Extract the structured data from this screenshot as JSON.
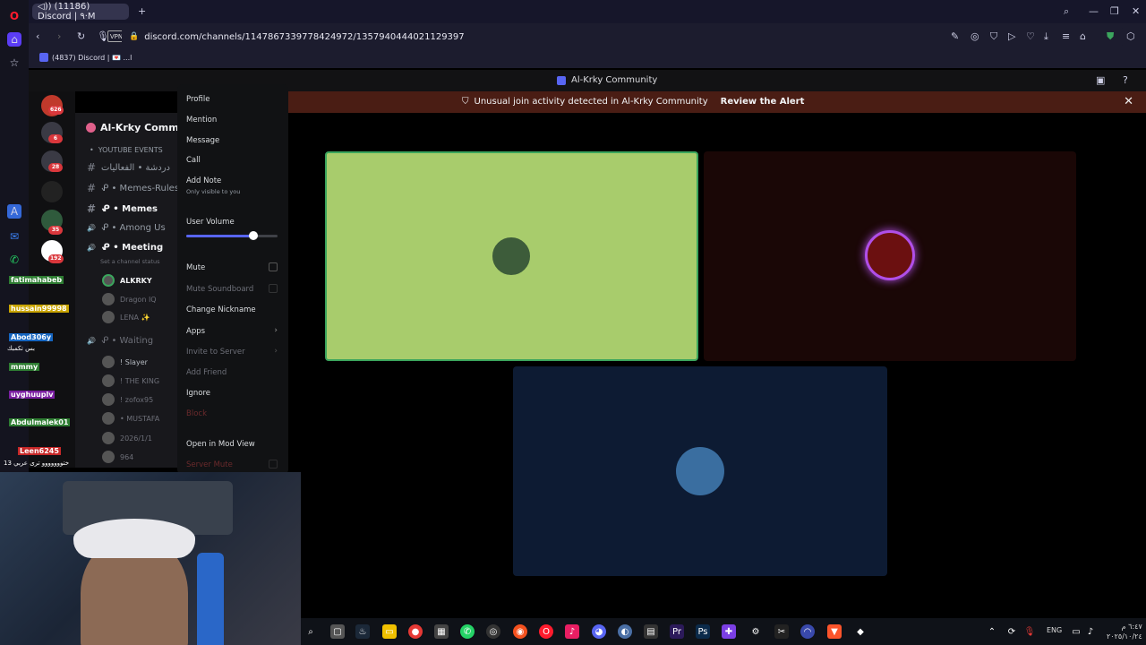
{
  "browser": {
    "tab_title": "◁)) (11186) Discord | ٩·M",
    "url": "discord.com/channels/1147867339778424972/1357940444021129397",
    "vpn": "VPN",
    "bookmark": "(4837) Discord | 💌 ...l"
  },
  "discord": {
    "window_title": "Al-Krky Community",
    "alert": {
      "text": "Unusual join activity detected in Al-Krky Community",
      "link": "Review the Alert"
    },
    "server_badges": [
      "626",
      "6",
      "28",
      "35",
      "192"
    ],
    "sidebar": {
      "server_name": "Al-Krky Communi",
      "channels": [
        {
          "icon": "•",
          "label": "YOUTUBE EVENTS"
        },
        {
          "icon": "#",
          "label": "دردشة • الفعاليات"
        },
        {
          "icon": "#",
          "label": "ᕵ • Memes-Rules"
        },
        {
          "icon": "#",
          "label": "ᕵ • Memes"
        },
        {
          "icon": "🔊",
          "label": "ᕵ • Among Us"
        },
        {
          "icon": "🔊",
          "label": "ᕵ • Meeting"
        }
      ],
      "channel_status": "Set a channel status",
      "meeting_users": [
        "ALKRKY",
        "Dragon IQ",
        "LENA ✨"
      ],
      "waiting_label": "ᕵ • Waiting",
      "waiting_users": [
        "! Slayer",
        "! THE KING",
        "! zofox95",
        "• MUSTAFA",
        "2026/1/1",
        "964"
      ]
    },
    "context_menu": {
      "profile": "Profile",
      "mention": "Mention",
      "message": "Message",
      "call": "Call",
      "add_note": "Add Note",
      "add_note_sub": "Only visible to you",
      "user_volume": "User Volume",
      "volume_level": 0.74,
      "mute": "Mute",
      "mute_soundboard": "Mute Soundboard",
      "change_nickname": "Change Nickname",
      "apps": "Apps",
      "invite_to_server": "Invite to Server",
      "add_friend": "Add Friend",
      "ignore": "Ignore",
      "block": "Block",
      "open_mod_view": "Open in Mod View",
      "server_mute": "Server Mute"
    }
  },
  "stream_overlay": {
    "viewers": [
      {
        "name": "fatimahabeb",
        "color": "#2e7d32"
      },
      {
        "name": "hussain99998",
        "color": "#c8a400"
      },
      {
        "name": "Abod306y",
        "color": "#1565c0"
      },
      {
        "name": "mmmy",
        "color": "#2e7d32"
      },
      {
        "name": "uyghuuplv",
        "color": "#7b1fa2"
      },
      {
        "name": "Abdulmalek01",
        "color": "#2e7d32"
      },
      {
        "name": "Leen6245",
        "color": "#c62828"
      }
    ],
    "lines": [
      "بس تكمبك",
      "ختووووووو ترى عربي 13"
    ]
  },
  "taskbar": {
    "lang": "ENG",
    "time": "٦:٤٧ م",
    "date": "٢٠٢٥/١٠/٢٤"
  },
  "colors": {
    "accent": "#5865f2",
    "speaking": "#3ba55d",
    "alert_bg": "#4a1d14"
  }
}
